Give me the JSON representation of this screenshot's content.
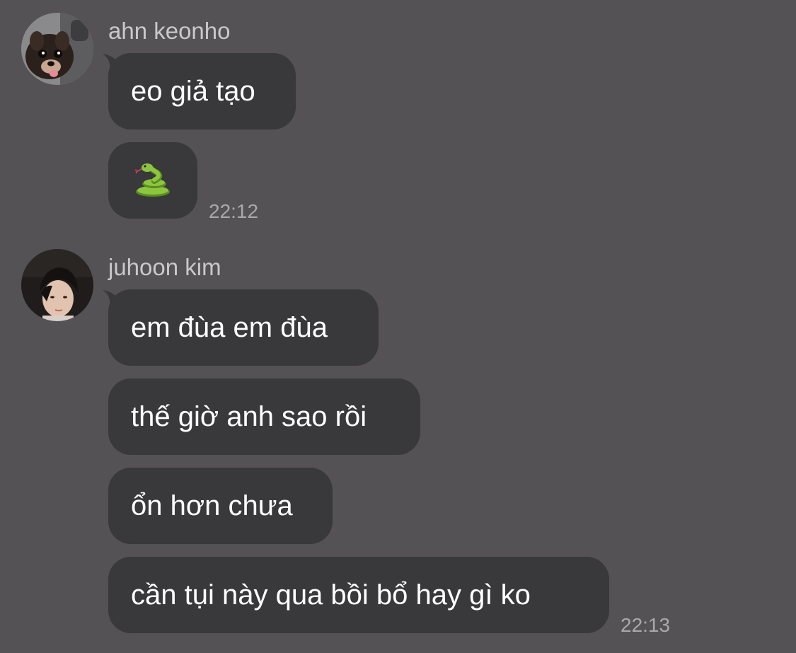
{
  "messages": [
    {
      "sender": "ahn keonho",
      "avatar_icon": "dog-avatar-icon",
      "bubbles": [
        {
          "text": "eo giả tạo"
        },
        {
          "emoji": "snake-emoji-icon"
        }
      ],
      "time": "22:12"
    },
    {
      "sender": "juhoon kim",
      "avatar_icon": "person-avatar-icon",
      "bubbles": [
        {
          "text": "em đùa em đùa"
        },
        {
          "text": "thế giờ anh sao rồi"
        },
        {
          "text": "ổn hơn chưa"
        },
        {
          "text": "cần tụi này qua bồi bổ hay gì ko"
        }
      ],
      "time": "22:13"
    }
  ],
  "colors": {
    "background": "#545255",
    "bubble": "#39383b",
    "text": "#ffffff",
    "sender": "#c9c8cb",
    "time": "#a9a8ab"
  }
}
